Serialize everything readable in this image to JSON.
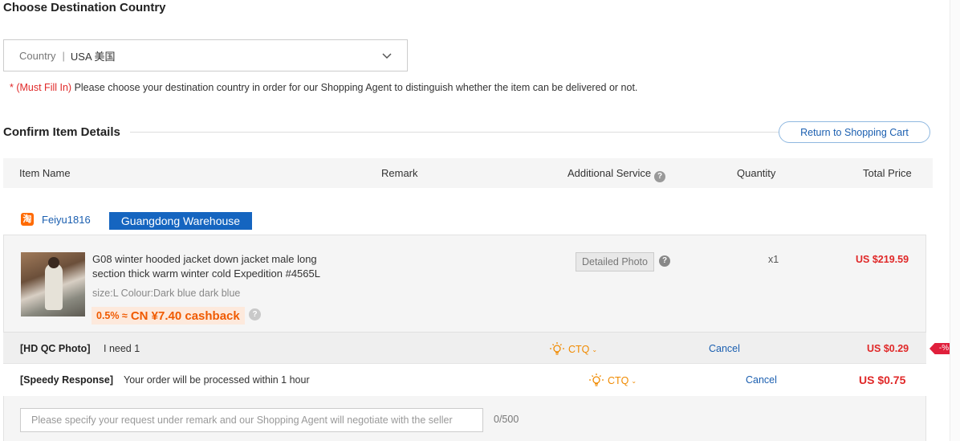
{
  "destination": {
    "title": "Choose Destination Country",
    "country_label": "Country",
    "country_separator": "|",
    "country_value": "USA 美国",
    "hint_required": "*  (Must Fill In)",
    "hint_text": " Please choose your destination country in order for our Shopping Agent to distinguish whether the item can be delivered or not."
  },
  "confirm": {
    "title": "Confirm Item Details",
    "return_button": "Return to Shopping Cart"
  },
  "table_headers": {
    "item_name": "Item Name",
    "remark": "Remark",
    "additional_service": "Additional Service",
    "quantity": "Quantity",
    "total_price": "Total Price"
  },
  "seller": {
    "icon_glyph": "淘",
    "name": "Feiyu1816",
    "warehouse": "Guangdong Warehouse"
  },
  "item": {
    "title": "G08 winter hooded jacket down jacket male long section thick warm winter cold Expedition #4565L",
    "spec": "size:L Colour:Dark blue dark blue",
    "cashback_pct": "0.5% ≈",
    "cashback_amount": "CN  ¥7.40 cashback",
    "detailed_photo": "Detailed Photo",
    "quantity": "x1",
    "price": "US $219.59"
  },
  "services": [
    {
      "name": "[HD QC Photo]",
      "description": "I need 1",
      "provider": "CTQ",
      "cancel": "Cancel",
      "price": "US $0.29",
      "discount_tag": "-%"
    },
    {
      "name": "[Speedy Response]",
      "description": "Your order will be processed within 1 hour",
      "provider": "CTQ",
      "cancel": "Cancel",
      "price": "US $0.75"
    }
  ],
  "remark": {
    "placeholder": "Please specify your request under remark and our Shopping Agent will negotiate with the seller",
    "value": "",
    "counter": "0/500"
  },
  "colors": {
    "link_blue": "#1b5fb0",
    "warehouse_blue": "#1565c0",
    "price_red": "#e02828",
    "ctq_orange": "#f08a00",
    "cashback_orange": "#f05a00"
  },
  "icons": {
    "dropdown": "chevron-down-icon",
    "help": "question-circle-icon",
    "ctq": "lightbulb-icon",
    "seller": "taobao-icon"
  }
}
